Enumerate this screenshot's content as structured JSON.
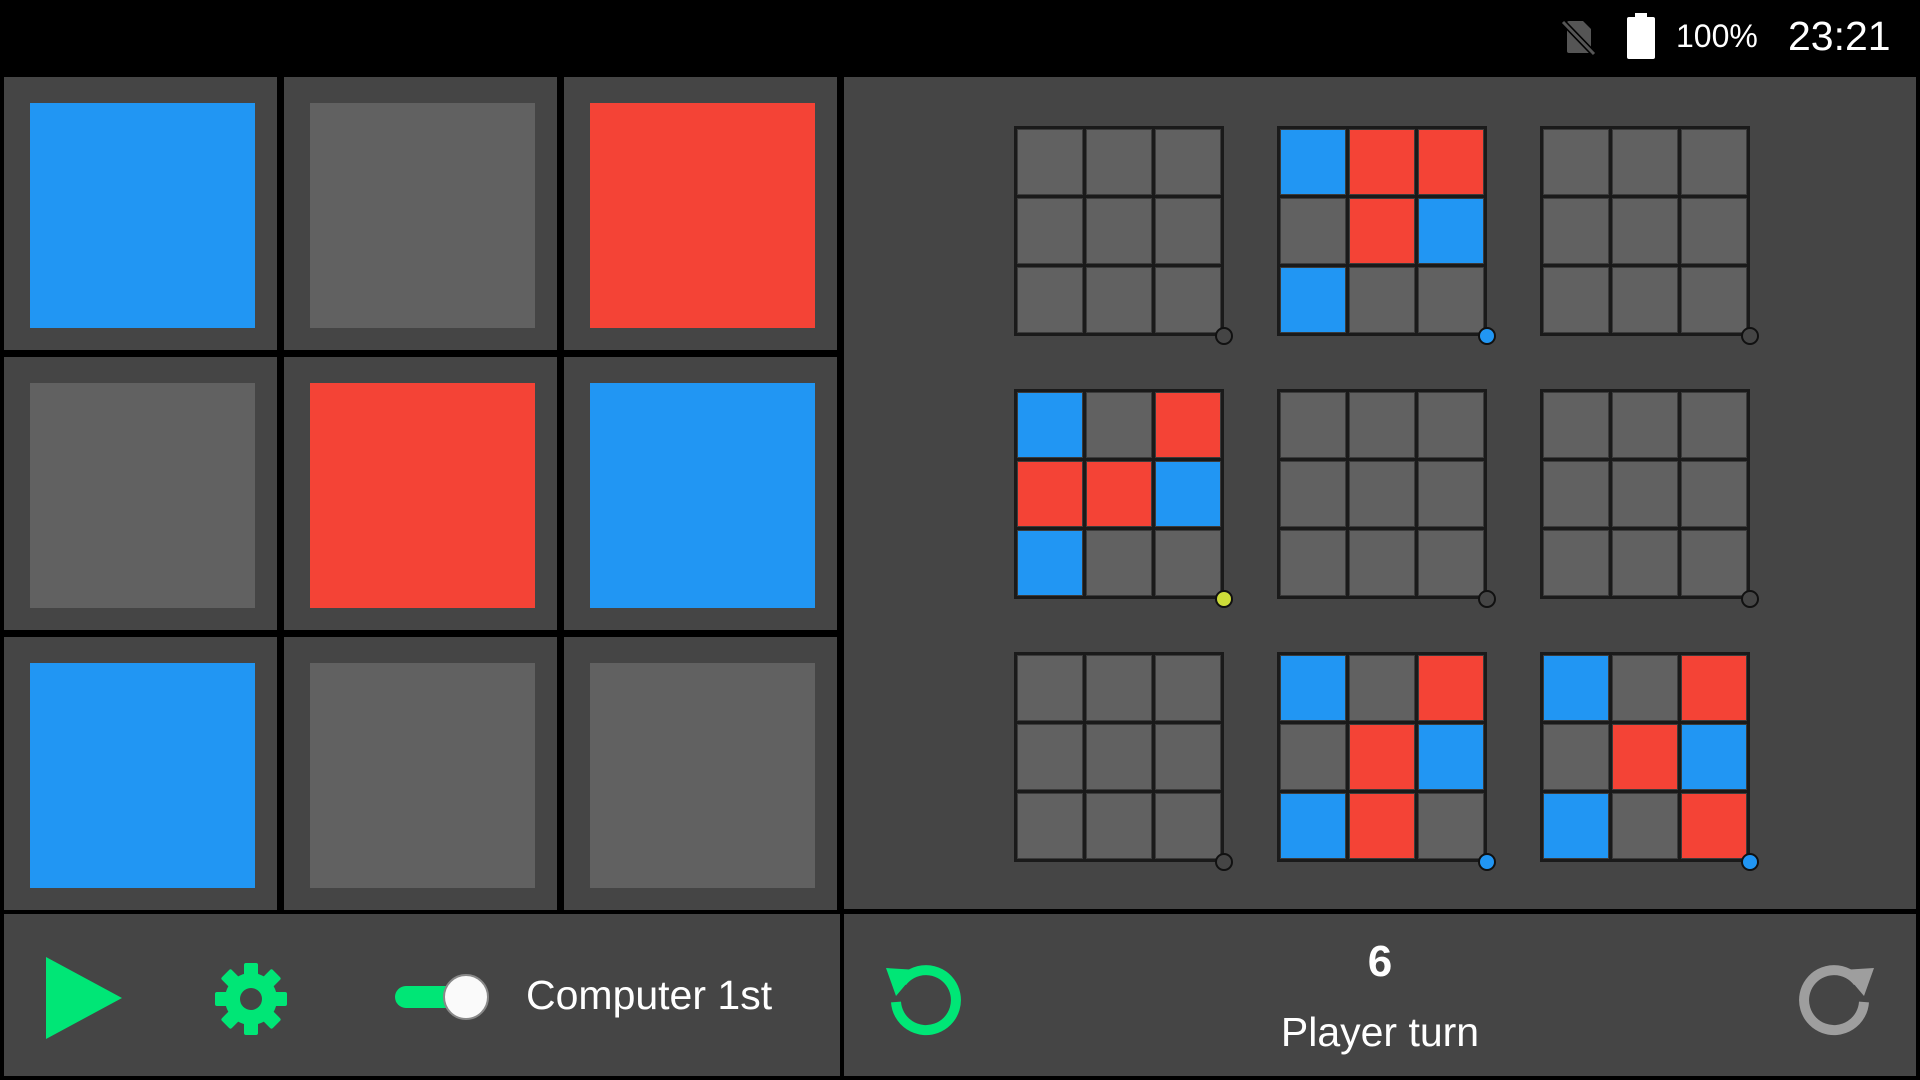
{
  "status_bar": {
    "no_sim_icon": "no-sim-icon",
    "battery_icon": "battery-full-icon",
    "battery_percent": "100%",
    "time": "23:21"
  },
  "colors": {
    "blue": "#2196f3",
    "red": "#f44336",
    "empty": "#616161",
    "panel": "#454545",
    "accent_green": "#00e676",
    "dot_yellow": "#cddc39"
  },
  "main_board": [
    [
      "blue",
      "empty",
      "red"
    ],
    [
      "empty",
      "red",
      "blue"
    ],
    [
      "blue",
      "empty",
      "empty"
    ]
  ],
  "history_boards": [
    {
      "cells": [
        [
          "empty",
          "empty",
          "empty"
        ],
        [
          "empty",
          "empty",
          "empty"
        ],
        [
          "empty",
          "empty",
          "empty"
        ]
      ],
      "marker": "empty"
    },
    {
      "cells": [
        [
          "blue",
          "red",
          "red"
        ],
        [
          "empty",
          "red",
          "blue"
        ],
        [
          "blue",
          "empty",
          "empty"
        ]
      ],
      "marker": "blue"
    },
    {
      "cells": [
        [
          "empty",
          "empty",
          "empty"
        ],
        [
          "empty",
          "empty",
          "empty"
        ],
        [
          "empty",
          "empty",
          "empty"
        ]
      ],
      "marker": "empty"
    },
    {
      "cells": [
        [
          "blue",
          "empty",
          "red"
        ],
        [
          "red",
          "red",
          "blue"
        ],
        [
          "blue",
          "empty",
          "empty"
        ]
      ],
      "marker": "yellow"
    },
    {
      "cells": [
        [
          "empty",
          "empty",
          "empty"
        ],
        [
          "empty",
          "empty",
          "empty"
        ],
        [
          "empty",
          "empty",
          "empty"
        ]
      ],
      "marker": "empty"
    },
    {
      "cells": [
        [
          "empty",
          "empty",
          "empty"
        ],
        [
          "empty",
          "empty",
          "empty"
        ],
        [
          "empty",
          "empty",
          "empty"
        ]
      ],
      "marker": "empty"
    },
    {
      "cells": [
        [
          "empty",
          "empty",
          "empty"
        ],
        [
          "empty",
          "empty",
          "empty"
        ],
        [
          "empty",
          "empty",
          "empty"
        ]
      ],
      "marker": "empty"
    },
    {
      "cells": [
        [
          "blue",
          "empty",
          "red"
        ],
        [
          "empty",
          "red",
          "blue"
        ],
        [
          "blue",
          "red",
          "empty"
        ]
      ],
      "marker": "blue"
    },
    {
      "cells": [
        [
          "blue",
          "empty",
          "red"
        ],
        [
          "empty",
          "red",
          "blue"
        ],
        [
          "blue",
          "empty",
          "red"
        ]
      ],
      "marker": "blue"
    }
  ],
  "controls": {
    "play_icon": "play-icon",
    "settings_icon": "gear-icon",
    "computer_first_enabled": true,
    "mode_label": "Computer 1st"
  },
  "info": {
    "undo_icon": "undo-icon",
    "redo_icon": "redo-icon",
    "move_count": "6",
    "turn_label": "Player turn"
  }
}
